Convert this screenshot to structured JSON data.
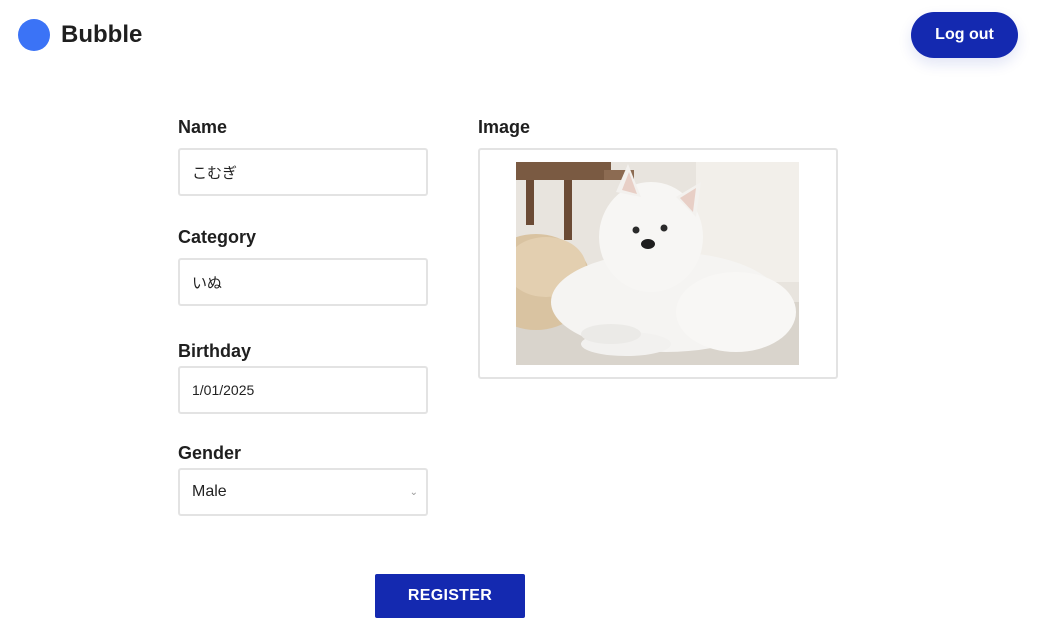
{
  "header": {
    "brand": "Bubble",
    "logout_label": "Log out",
    "accent": "#1429b0",
    "logo_color": "#3b73f6"
  },
  "form": {
    "name": {
      "label": "Name",
      "value": "こむぎ"
    },
    "category": {
      "label": "Category",
      "value": "いぬ"
    },
    "birthday": {
      "label": "Birthday",
      "value": "1/01/2025"
    },
    "gender": {
      "label": "Gender",
      "value": "Male"
    },
    "image": {
      "label": "Image"
    },
    "register_label": "REGISTER"
  }
}
